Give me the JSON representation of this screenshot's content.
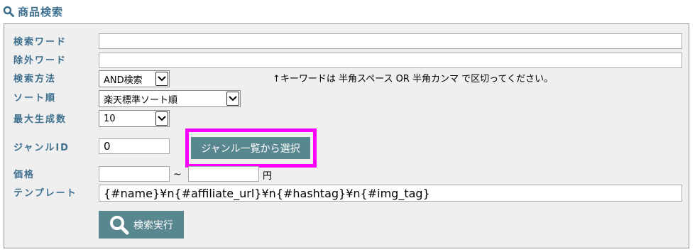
{
  "header": {
    "title": "商品検索",
    "icon": "search-icon"
  },
  "form": {
    "keyword": {
      "label": "検索ワード",
      "value": "",
      "placeholder": ""
    },
    "exclude": {
      "label": "除外ワード",
      "value": "",
      "placeholder": ""
    },
    "method": {
      "label": "検索方法",
      "selected": "AND検索"
    },
    "note": "↑キーワードは 半角スペース OR 半角カンマ で区切ってください。",
    "sort": {
      "label": "ソート順",
      "selected": "楽天標準ソート順"
    },
    "max": {
      "label": "最大生成数",
      "selected": "10"
    },
    "genre": {
      "label": "ジャンルID",
      "value": "0",
      "button_label": "ジャンル一覧から選択"
    },
    "price": {
      "label": "価格",
      "min_value": "",
      "tilde": "~",
      "max_value": "",
      "unit": "円"
    },
    "template": {
      "label": "テンプレート",
      "value": "{#name}¥n{#affiliate_url}¥n{#hashtag}¥n{#img_tag}"
    },
    "submit": {
      "label": "検索実行",
      "icon": "search-icon"
    }
  },
  "colors": {
    "label": "#3d6f8e",
    "button": "#59878f",
    "highlight": "#ff00ff",
    "panel_bg": "#efefef"
  }
}
